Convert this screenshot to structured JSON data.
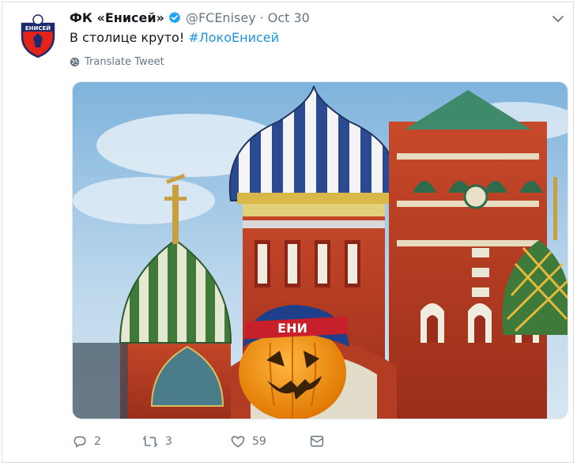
{
  "tweet": {
    "display_name": "ФК «Енисей»",
    "handle": "@FCEnisey",
    "separator": "·",
    "date": "Oct 30",
    "text_plain": "В столице круто! ",
    "text_hashtag": "#ЛокоЕнисей",
    "translate_label": "Translate Tweet",
    "avatar_text": "ЕНИСЕЙ",
    "hat_text": "ЕНИ"
  },
  "actions": {
    "reply_count": "2",
    "retweet_count": "3",
    "like_count": "59"
  },
  "icons": {
    "verified": "verified-badge-icon",
    "caret": "chevron-down-icon",
    "globe": "globe-icon",
    "reply": "reply-icon",
    "retweet": "retweet-icon",
    "like": "heart-icon",
    "dm": "envelope-icon"
  },
  "colors": {
    "accent": "#1b95e0",
    "secondary_text": "#657786",
    "primary_text": "#14171a"
  }
}
